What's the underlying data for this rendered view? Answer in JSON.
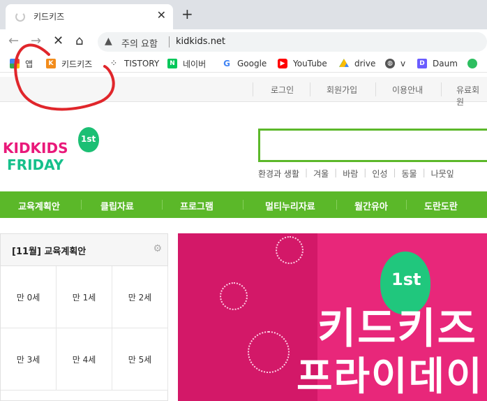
{
  "browser": {
    "tab_title": "키드키즈",
    "omnibox_warning": "주의 요함",
    "url": "kidkids.net"
  },
  "bookmarks": [
    {
      "label": "앱",
      "icon": "apps-grid-icon",
      "color": "#ea4335"
    },
    {
      "label": "키드키즈",
      "icon": "kidkids-favicon",
      "color": "#f28c1c"
    },
    {
      "label": "TISTORY",
      "icon": "tistory-icon",
      "color": "#333333"
    },
    {
      "label": "네이버",
      "icon": "naver-icon",
      "color": "#03c75a"
    },
    {
      "label": "Google",
      "icon": "google-icon",
      "color": "#4285f4"
    },
    {
      "label": "YouTube",
      "icon": "youtube-icon",
      "color": "#ff0000"
    },
    {
      "label": "drive",
      "icon": "drive-icon",
      "color": "#fbbc05"
    },
    {
      "label": "v",
      "icon": "globe-icon",
      "color": "#555555"
    },
    {
      "label": "Daum",
      "icon": "daum-icon",
      "color": "#6a5cff"
    },
    {
      "label": "",
      "icon": "evernote-icon",
      "color": "#2dbe60"
    }
  ],
  "site": {
    "topnav": [
      "로그인",
      "회원가입",
      "이용안내",
      "유료회원"
    ],
    "logo": {
      "line1": "KIDKIDS",
      "line2": "FRIDAY",
      "badge": "1st"
    },
    "search_keywords": [
      "환경과 생활",
      "겨울",
      "바람",
      "인성",
      "동물",
      "나뭇잎"
    ],
    "menu": [
      "교육계획안",
      "클립자료",
      "프로그램",
      "멀티누리자료",
      "월간유아",
      "도란도란"
    ],
    "plan_panel": {
      "title": "[11월] 교육계획안",
      "ages": [
        "만 0세",
        "만 1세",
        "만 2세",
        "만 3세",
        "만 4세",
        "만 5세"
      ]
    },
    "banner": {
      "badge": "1st",
      "line1": "키드키즈",
      "line2": "프라이데이"
    }
  },
  "colors": {
    "brand_green": "#5bb829",
    "banner_pink": "#e8277a",
    "annotation_red": "#e0262b"
  }
}
